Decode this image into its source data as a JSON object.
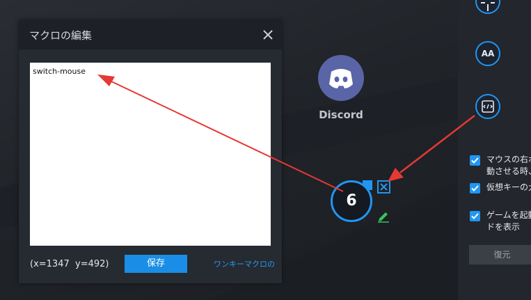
{
  "dialog": {
    "title": "マクロの編集",
    "editor_text": "switch-mouse",
    "coords": "(x=1347  y=492)",
    "save_label": "保存",
    "oneclick_link": "ワンキーマクロの"
  },
  "discord": {
    "label": "Discord"
  },
  "macro_key": {
    "number": "6"
  },
  "right_panel": {
    "tools": [
      "crosshair-tool",
      "aa-tool",
      "macro-tool"
    ],
    "aa_label": "AA",
    "options": [
      {
        "line1": "マウスの右ボ",
        "line2": "動させる時、"
      },
      {
        "line1": "仮想キーの大"
      },
      {
        "line1": "ゲームを起動",
        "line2": "ドを表示"
      }
    ],
    "reset_label": "復元"
  },
  "colors": {
    "accent": "#2196f3",
    "arrow": "#e53935",
    "edit_icon": "#39c35a"
  }
}
